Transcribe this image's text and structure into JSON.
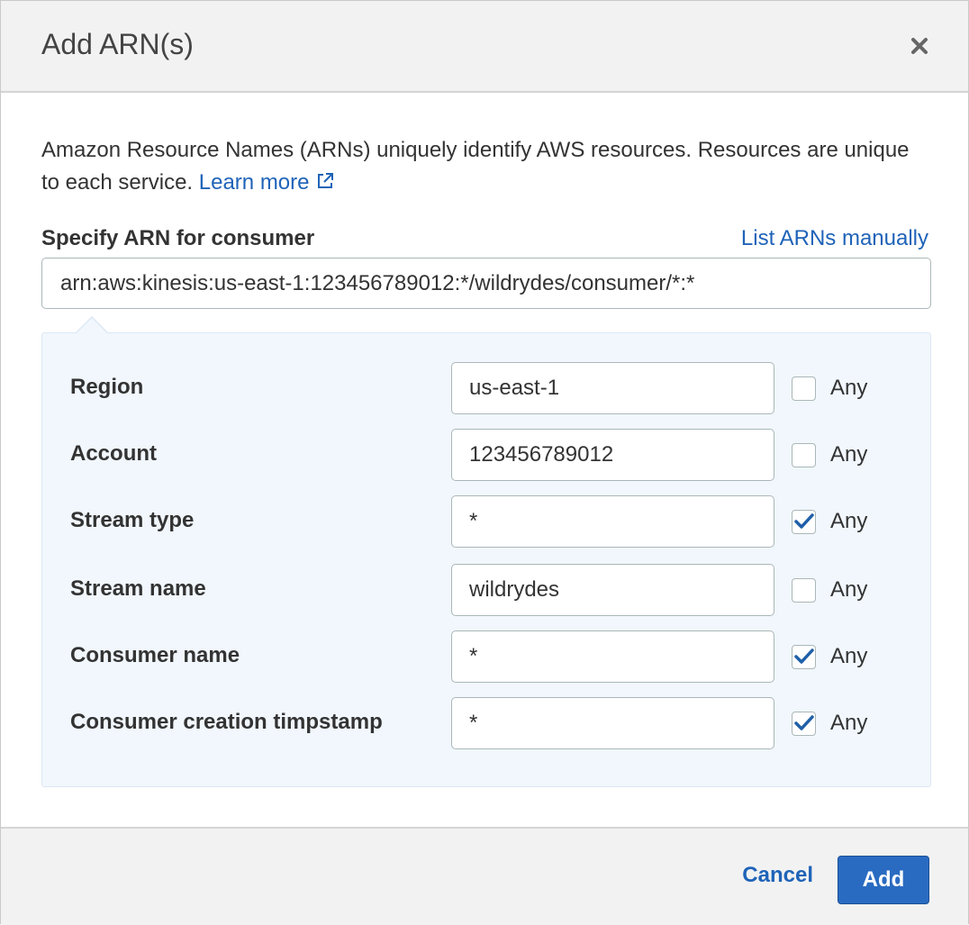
{
  "dialog": {
    "title": "Add ARN(s)",
    "close_icon": "close-icon"
  },
  "description": {
    "text": "Amazon Resource Names (ARNs) uniquely identify AWS resources. Resources are unique to each service.",
    "learn_more": "Learn more",
    "external_icon": "external-link-icon"
  },
  "arn": {
    "label": "Specify ARN for consumer",
    "list_manually": "List ARNs manually",
    "value": "arn:aws:kinesis:us-east-1:123456789012:*/wildrydes/consumer/*:*"
  },
  "fields": [
    {
      "label": "Region",
      "value": "us-east-1",
      "any_label": "Any",
      "any_checked": false
    },
    {
      "label": "Account",
      "value": "123456789012",
      "any_label": "Any",
      "any_checked": false
    },
    {
      "label": "Stream type",
      "value": "*",
      "any_label": "Any",
      "any_checked": true
    },
    {
      "label": "Stream name",
      "value": "wildrydes",
      "any_label": "Any",
      "any_checked": false
    },
    {
      "label": "Consumer name",
      "value": "*",
      "any_label": "Any",
      "any_checked": true
    },
    {
      "label": "Consumer creation timpstamp",
      "value": "*",
      "any_label": "Any",
      "any_checked": true
    }
  ],
  "footer": {
    "cancel_label": "Cancel",
    "add_label": "Add"
  },
  "colors": {
    "link": "#1f63b8",
    "primary_button": "#2a6bc2",
    "panel_background": "#f1f7fd",
    "header_background": "#f2f2f2"
  }
}
